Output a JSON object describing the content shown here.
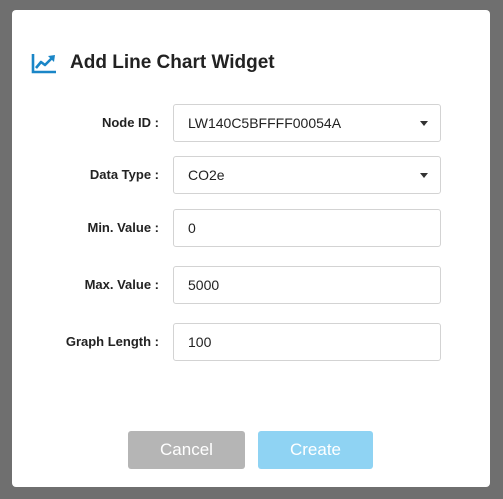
{
  "dialog": {
    "title": "Add Line Chart Widget",
    "icon": "line-chart-icon",
    "accent_color": "#1a86c7"
  },
  "form": {
    "node_id": {
      "label": "Node ID :",
      "value": "LW140C5BFFFF00054A"
    },
    "data_type": {
      "label": "Data Type :",
      "value": "CO2e"
    },
    "min_value": {
      "label": "Min. Value :",
      "value": "0"
    },
    "max_value": {
      "label": "Max. Value :",
      "value": "5000"
    },
    "graph_length": {
      "label": "Graph Length :",
      "value": "100"
    }
  },
  "buttons": {
    "cancel_label": "Cancel",
    "create_label": "Create",
    "cancel_color": "#b5b5b5",
    "create_color": "#8fd3f3"
  }
}
